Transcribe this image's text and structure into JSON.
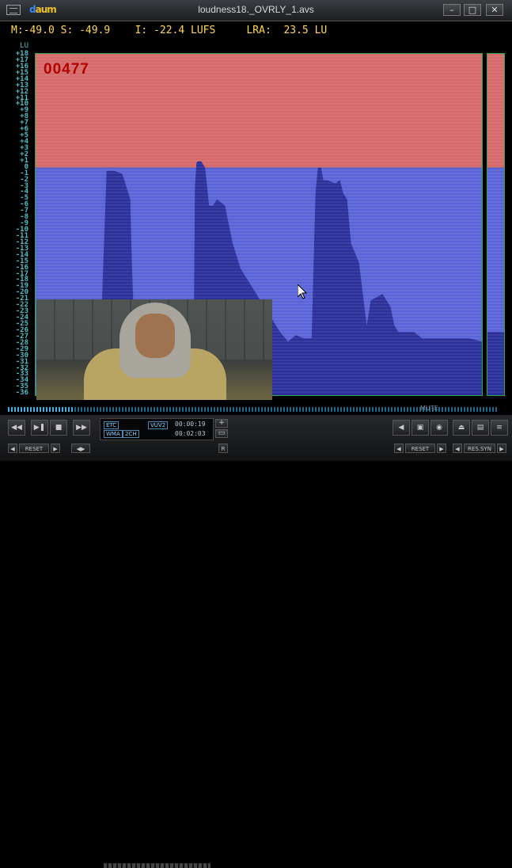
{
  "window": {
    "title": "loudness18._OVRLY_1.avs",
    "logo": "daum"
  },
  "stats": {
    "m_label": "M:",
    "m_value": "-49.0",
    "s_label": "S:",
    "s_value": "-49.9",
    "i_label": "I:",
    "i_value": "-22.4 LUFS",
    "lra_label": "LRA:",
    "lra_value": "23.5 LU"
  },
  "scale": {
    "unit": "LU",
    "labels": [
      "+18",
      "+17",
      "+16",
      "+15",
      "+14",
      "+13",
      "+12",
      "+11",
      "+10",
      "+9",
      "+8",
      "+7",
      "+6",
      "+5",
      "+4",
      "+3",
      "+2",
      "+1",
      "0",
      "-1",
      "-2",
      "-3",
      "-4",
      "-5",
      "-6",
      "-7",
      "-8",
      "-9",
      "-10",
      "-11",
      "-12",
      "-13",
      "-14",
      "-15",
      "-16",
      "-17",
      "-18",
      "-19",
      "-20",
      "-21",
      "-22",
      "-23",
      "-24",
      "-25",
      "-26",
      "-27",
      "-28",
      "-29",
      "-30",
      "-31",
      "-32",
      "-33",
      "-34",
      "-35",
      "-36"
    ]
  },
  "overlay": {
    "frame_counter": "00477"
  },
  "colors": {
    "above_target": "#d66a6a",
    "below_target": "#5a63d8",
    "loudness_fill": "#2a2f9a",
    "scale_text": "#4fc0c8",
    "stats_text": "#ffd85a",
    "frame_border": "#2aa84a"
  },
  "chart_data": {
    "type": "area",
    "x": [
      0,
      10,
      20,
      30,
      40,
      50,
      60,
      70,
      80,
      90,
      100,
      110,
      120,
      122,
      124,
      126,
      128,
      130,
      132,
      134,
      136,
      140,
      142,
      150,
      170,
      190,
      200,
      202,
      204,
      206,
      210,
      215,
      220,
      225,
      230,
      240,
      250,
      260,
      270,
      280,
      290,
      300,
      310,
      320,
      330,
      340,
      350,
      355,
      358,
      360,
      362,
      365,
      370,
      380,
      386,
      390,
      395,
      400,
      410,
      418,
      420,
      425,
      440,
      445,
      450,
      455,
      460,
      470,
      480,
      490,
      500,
      510,
      520,
      530,
      540,
      550,
      566
    ],
    "y": [
      -36,
      -36,
      -36,
      -36,
      -36,
      -36,
      -36,
      -36,
      -36,
      -0.5,
      -0.5,
      -1,
      -5,
      -15,
      -22,
      -30,
      -36,
      -36,
      -36,
      -36,
      -36,
      -36,
      -36,
      -36,
      -36,
      -36,
      -36,
      -3,
      0.8,
      1,
      1,
      0,
      -6,
      -6,
      -5,
      -6,
      -12,
      -16,
      -18,
      -20,
      -22,
      -24,
      -26,
      -27.5,
      -26.5,
      -27,
      -27,
      -4,
      0,
      0,
      0,
      -2,
      -2,
      -2.5,
      -2,
      -4,
      -5,
      -12,
      -15,
      -23,
      -25,
      -21,
      -20,
      -21,
      -22,
      -25,
      -26,
      -26,
      -26,
      -27,
      -27,
      -27,
      -27,
      -27,
      -27,
      -27,
      -27.5
    ],
    "xlim": [
      0,
      566
    ],
    "ylim": [
      -36,
      18
    ],
    "target": 0,
    "sidebar_value": -26
  },
  "controls": {
    "tag_etc": "ETC",
    "tag_vuv": "VUV2",
    "time1": "00:00:19",
    "tag_wma": "WMA",
    "tag_2ch": "2CH",
    "time2": "00:02:03",
    "mute_label": "MUTE",
    "reset1": "RESET",
    "reset2": "RESET",
    "resync": "RES.SYN"
  }
}
